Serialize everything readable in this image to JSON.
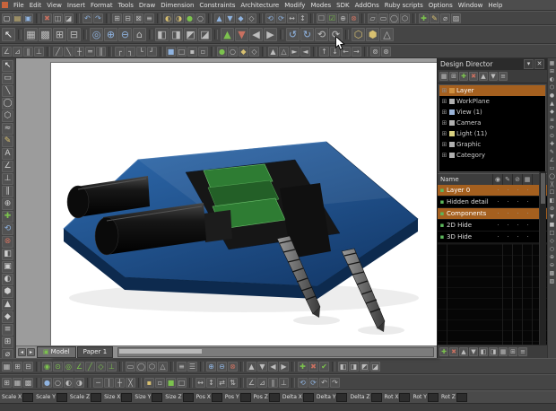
{
  "menu": {
    "items": [
      "File",
      "Edit",
      "View",
      "Insert",
      "Format",
      "Tools",
      "Draw",
      "Dimension",
      "Constraints",
      "Architecture",
      "Modify",
      "Modes",
      "SDK",
      "AddOns",
      "Ruby scripts",
      "Options",
      "Window",
      "Help"
    ]
  },
  "toolbars": {
    "row1": [
      "▢~#e0e0e0",
      "▤~#e0c878",
      "▣~#8fb3e0",
      "|",
      "✖~#c87060",
      "◫~#bdbdbd",
      "◪~#bdbdbd",
      "|",
      "↶~#8fb3e0",
      "↷~#8fb3e0",
      "|",
      "⊞~#bdbdbd",
      "⊟~#bdbdbd",
      "⊠~#bdbdbd",
      "≡~#bdbdbd",
      "|",
      "◐~#d8c070",
      "◑~#d8c070",
      "●~#7cc24e",
      "○~#bdbdbd",
      "|",
      "▲~#8fb3e0",
      "▼~#8fb3e0",
      "◆~#8fb3e0",
      "◇~#bdbdbd",
      "|",
      "⟲~#8fb3e0",
      "⟳~#8fb3e0",
      "↔~#bdbdbd",
      "↕~#bdbdbd",
      "|",
      "☐~#bdbdbd",
      "☑~#7cc24e",
      "⊕~#bdbdbd",
      "⊗~#c87060",
      "|",
      "▱~#bdbdbd",
      "▭~#bdbdbd",
      "◯~#bdbdbd",
      "⬡~#bdbdbd",
      "|",
      "✚~#7cc24e",
      "✎~#d8c070",
      "⌀~#bdbdbd",
      "▨~#bdbdbd"
    ],
    "row2": [
      "↖~#eeeeee",
      "|",
      "▦~#bdbdbd",
      "▩~#bdbdbd",
      "⊞~#bdbdbd",
      "⊟~#bdbdbd",
      "|",
      "◎~#8fb3e0",
      "⊕~#8fb3e0",
      "⊖~#8fb3e0",
      "⌂~#bdbdbd",
      "|",
      "◧~#bdbdbd",
      "◨~#bdbdbd",
      "◩~#bdbdbd",
      "◪~#bdbdbd",
      "|",
      "▲~#7cc24e",
      "▼~#c87060",
      "◀~#bdbdbd",
      "▶~#bdbdbd",
      "|",
      "↺~#8fb3e0",
      "↻~#8fb3e0",
      "⟲~#bdbdbd",
      "⟳~#bdbdbd",
      "|",
      "⬡~#d8c070",
      "⬢~#d8c070",
      "△~#bdbdbd"
    ],
    "row3": [
      "∠~#bdbdbd",
      "⊿~#bdbdbd",
      "∥~#bdbdbd",
      "⊥~#bdbdbd",
      "|",
      "╱~#bdbdbd",
      "╲~#bdbdbd",
      "┼~#bdbdbd",
      "═~#bdbdbd",
      "║~#bdbdbd",
      "|",
      "┌~#bdbdbd",
      "┐~#bdbdbd",
      "└~#bdbdbd",
      "┘~#bdbdbd",
      "|",
      "■~#8fb3e0",
      "□~#bdbdbd",
      "▪~#bdbdbd",
      "▫~#bdbdbd",
      "|",
      "●~#7cc24e",
      "○~#bdbdbd",
      "◆~#d8c070",
      "◇~#bdbdbd",
      "|",
      "▲~#bdbdbd",
      "△~#bdbdbd",
      "►~#bdbdbd",
      "◄~#bdbdbd",
      "|",
      "↑~#bdbdbd",
      "↓~#bdbdbd",
      "←~#bdbdbd",
      "→~#bdbdbd",
      "|",
      "⊚~#bdbdbd",
      "⊛~#bdbdbd"
    ],
    "left": [
      "↖~#ffffff",
      "▭~#cfcfcf",
      "╲~#cfcfcf",
      "◯~#cfcfcf",
      "⬡~#cfcfcf",
      "≈~#cfcfcf",
      "✎~#d8c070",
      "A~#cfcfcf",
      "∠~#cfcfcf",
      "⊥~#cfcfcf",
      "∥~#cfcfcf",
      "⊕~#cfcfcf",
      "✚~#7cc24e",
      "⟲~#8fb3e0",
      "⊗~#c87060",
      "◧~#cfcfcf",
      "▣~#cfcfcf",
      "◐~#cfcfcf",
      "⬢~#cfcfcf",
      "▲~#cfcfcf",
      "◆~#cfcfcf",
      "≡~#cfcfcf",
      "⊞~#cfcfcf",
      "⌀~#cfcfcf"
    ],
    "right_edge": [
      "▦",
      "⊞",
      "◐",
      "⬡",
      "●",
      "▲",
      "◆",
      "≡",
      "⟳",
      "⊙",
      "✚",
      "✎",
      "∠",
      "▭",
      "◯",
      "╳",
      "☐",
      "◧",
      "⊚",
      "▼",
      "■",
      "□",
      "◇",
      "○",
      "⊕",
      "⊖",
      "▩",
      "▨"
    ],
    "bottom1": [
      "▦~#bdbdbd",
      "⊞~#bdbdbd",
      "⊟~#bdbdbd",
      "|",
      "◉~#7cc24e",
      "⊙~#7cc24e",
      "◎~#7cc24e",
      "∠~#7cc24e",
      "╱~#7cc24e",
      "◇~#7cc24e",
      "⊥~#7cc24e",
      "|",
      "▭~#bdbdbd",
      "◯~#bdbdbd",
      "⬡~#bdbdbd",
      "△~#bdbdbd",
      "|",
      "≡~#bdbdbd",
      "☰~#bdbdbd",
      "|",
      "⊕~#8fb3e0",
      "⊖~#8fb3e0",
      "⊗~#c87060",
      "|",
      "▲~#bdbdbd",
      "▼~#bdbdbd",
      "◀~#bdbdbd",
      "▶~#bdbdbd",
      "|",
      "✚~#7cc24e",
      "✖~#c87060",
      "✔~#7cc24e",
      "|",
      "◧~#bdbdbd",
      "◨~#bdbdbd",
      "◩~#bdbdbd",
      "◪~#bdbdbd"
    ],
    "bottom2": [
      "⊞~#bdbdbd",
      "▦~#bdbdbd",
      "▩~#bdbdbd",
      "|",
      "●~#8fb3e0",
      "○~#bdbdbd",
      "◐~#bdbdbd",
      "◑~#bdbdbd",
      "|",
      "─~#bdbdbd",
      "│~#bdbdbd",
      "┼~#bdbdbd",
      "╳~#bdbdbd",
      "|",
      "▪~#d8c070",
      "▫~#bdbdbd",
      "■~#7cc24e",
      "□~#bdbdbd",
      "|",
      "↔~#bdbdbd",
      "↕~#bdbdbd",
      "⇄~#bdbdbd",
      "⇅~#bdbdbd",
      "|",
      "∠~#bdbdbd",
      "⊿~#bdbdbd",
      "∥~#bdbdbd",
      "⊥~#bdbdbd",
      "|",
      "⟲~#8fb3e0",
      "⟳~#8fb3e0",
      "↶~#bdbdbd",
      "↷~#bdbdbd"
    ]
  },
  "viewport": {
    "tabs": {
      "model": "Model",
      "paper": "Paper 1",
      "model_icon": "▣"
    },
    "tab_nav": [
      "◂~#e6e6e6",
      "▸~#e6e6e6"
    ]
  },
  "design_director": {
    "title": "Design Director",
    "title_buttons": [
      "▾~#cfcfcf",
      "✕~#cfcfcf"
    ],
    "toolbar": [
      "▦~#bdbdbd",
      "⊞~#bdbdbd",
      "✚~#7cc24e",
      "✖~#c87060",
      "▲~#bdbdbd",
      "▼~#bdbdbd",
      "≡~#bdbdbd"
    ],
    "tree": [
      {
        "label": "Layer",
        "selected": true,
        "color": "#d09040"
      },
      {
        "label": "WorkPlane",
        "color": "#b0b0b0"
      },
      {
        "label": "View (1)",
        "color": "#9ab4d8"
      },
      {
        "label": "Camera",
        "color": "#b0b0b0"
      },
      {
        "label": "Light (11)",
        "color": "#d8d080"
      },
      {
        "label": "Graphic",
        "color": "#b0b0b0"
      },
      {
        "label": "Category",
        "color": "#b0b0b0"
      }
    ],
    "layers": {
      "name_header": "Name",
      "columns": [
        "◉",
        "✎",
        "⊘",
        "▦"
      ],
      "rows": [
        {
          "label": "Layer 0",
          "highlight": true
        },
        {
          "label": "Hidden detail"
        },
        {
          "label": "Components",
          "highlight": true
        },
        {
          "label": "2D Hide"
        },
        {
          "label": "3D Hide"
        }
      ]
    },
    "bottom_toolbar": [
      "✚~#7cc24e",
      "✖~#c87060",
      "▲~#bdbdbd",
      "▼~#bdbdbd",
      "◧~#bdbdbd",
      "◨~#bdbdbd",
      "▦~#bdbdbd",
      "⊞~#bdbdbd",
      "≡~#bdbdbd"
    ]
  },
  "status_bar": {
    "fields": [
      "Scale X",
      "Scale Y",
      "Scale Z",
      "Size X",
      "Size Y",
      "Size Z",
      "Pos X",
      "Pos Y",
      "Pos Z",
      "Delta X",
      "Delta Y",
      "Delta Z",
      "Rot X",
      "Rot Y",
      "Rot Z"
    ]
  },
  "colors": {
    "selection_highlight": "#a5601f",
    "model_plate_blue": "#1d4e8c",
    "pcb_green": "#2e7c33"
  }
}
